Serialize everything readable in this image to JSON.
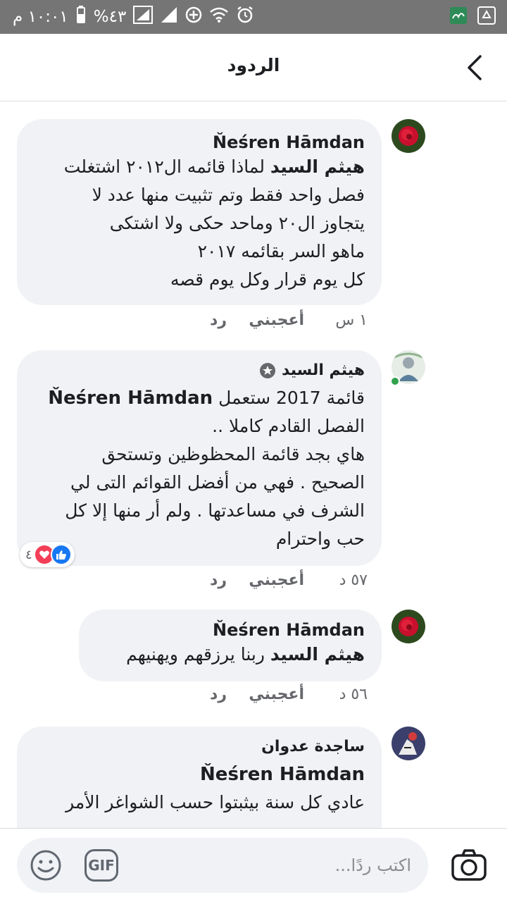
{
  "status_bar": {
    "time": "١٠:٠١ م",
    "battery": "%٤٣",
    "icons": [
      "battery-icon",
      "signal-icon",
      "signal-icon",
      "data-saver-icon",
      "wifi-icon",
      "alarm-icon",
      "recycle-icon"
    ]
  },
  "header": {
    "title": "الردود",
    "back_icon": "chevron-left-icon"
  },
  "comments": [
    {
      "author": "Ňeśren Hāmdan",
      "mention": "هيثم السيد",
      "lines": [
        "لماذا قائمه ال٢٠١٢  اشتغلت",
        "فصل واحد فقط  وتم  تثبيت منها عدد لا",
        "يتجاوز  ال٢٠  وماحد  حكى  ولا  اشتكى",
        "ماهو  السر  بقائمه ٢٠١٧",
        "كل  يوم قرار  وكل  يوم  قصه"
      ],
      "time": "١ س",
      "like": "أعجبني",
      "reply": "رد"
    },
    {
      "author": "هيثم السيد",
      "mention": "Ňeśren Hāmdan",
      "lines": [
        "قائمة 2017 ستعمل",
        "الفصل القادم كاملا ..",
        "هاي بجد قائمة المحظوظين وتستحق",
        "الصحيح  . فهي من أفضل القوائم التى لي",
        "الشرف في مساعدتها . ولم أر منها إلا كل",
        "حب واحترام"
      ],
      "time": "٥٧ د",
      "like": "أعجبني",
      "reply": "رد",
      "reaction_count": "٤"
    },
    {
      "author": "Ňeśren Hāmdan",
      "mention": "هيثم السيد",
      "lines": [
        "ربنا  يرزقهم  ويهنيهم"
      ],
      "time": "٥٦ د",
      "like": "أعجبني",
      "reply": "رد"
    },
    {
      "author": "ساجدة عدوان",
      "mention": "Ňeśren Hāmdan",
      "lines": [
        "عادي كل سنة بيثبتوا حسب الشواغر الأمر"
      ]
    }
  ],
  "composer": {
    "placeholder": "اكتب ردًا...",
    "gif_label": "GIF"
  },
  "colors": {
    "bubble": "#f0f2f5",
    "status_bar": "#757575",
    "like_blue": "#1877f2",
    "love_red": "#f33e58"
  }
}
